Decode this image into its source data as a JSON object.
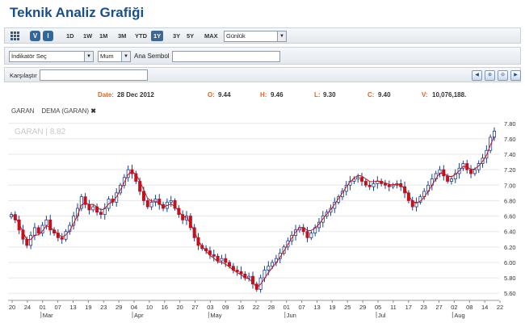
{
  "title": "Teknik Analiz Grafiği",
  "toolbar": {
    "v_label": "V",
    "i_label": "I",
    "periods": [
      "1D",
      "1W",
      "1M",
      "3M",
      "YTD",
      "1Y",
      "3Y",
      "5Y",
      "MAX"
    ],
    "active_period": "1Y",
    "interval_value": "Günlük"
  },
  "toolbar2": {
    "indicator_value": "İndikatör Seç",
    "chart_type_value": "Mum",
    "symbol_label": "Ana Sembol",
    "symbol_value": ""
  },
  "toolbar3": {
    "compare_label": "Karşılaştır",
    "compare_value": ""
  },
  "quote": {
    "date_label": "Date:",
    "date_value": "28 Dec 2012",
    "open_label": "O:",
    "open_value": "9.44",
    "high_label": "H:",
    "high_value": "9.46",
    "low_label": "L:",
    "low_value": "9.30",
    "close_label": "C:",
    "close_value": "9.40",
    "volume_label": "V:",
    "volume_value": "10,076,188."
  },
  "legend": {
    "series1": "GARAN",
    "series2": "DEMA (GARAN)",
    "remove_glyph": "✖"
  },
  "colors": {
    "up": "#ffffff",
    "down": "#c0121c",
    "dema": "#c0121c",
    "candle_outline": "#1b3f8f",
    "active_button": "#3d6896"
  },
  "chart_data": {
    "type": "candlestick",
    "watermark": "GARAN | 8.82",
    "ylim": [
      5.55,
      7.85
    ],
    "yticks": [
      5.6,
      5.8,
      6.0,
      6.2,
      6.4,
      6.6,
      6.8,
      7.0,
      7.2,
      7.4,
      7.6,
      7.8
    ],
    "x_day_ticks": [
      "20",
      "24",
      "01",
      "07",
      "13",
      "19",
      "23",
      "29",
      "04",
      "10",
      "16",
      "20",
      "27",
      "03",
      "09",
      "16",
      "22",
      "28",
      "01",
      "07",
      "13",
      "19",
      "25",
      "29",
      "05",
      "11",
      "17",
      "23",
      "27",
      "02",
      "08",
      "14",
      "22"
    ],
    "x_month_labels": [
      {
        "label": "Mar",
        "tick_index": 2
      },
      {
        "label": "Apr",
        "tick_index": 8
      },
      {
        "label": "May",
        "tick_index": 13
      },
      {
        "label": "Jun",
        "tick_index": 18
      },
      {
        "label": "Jul",
        "tick_index": 24
      },
      {
        "label": "Aug",
        "tick_index": 29
      }
    ],
    "closes": [
      6.62,
      6.55,
      6.42,
      6.3,
      6.22,
      6.35,
      6.45,
      6.38,
      6.48,
      6.55,
      6.42,
      6.38,
      6.32,
      6.3,
      6.4,
      6.48,
      6.6,
      6.7,
      6.85,
      6.75,
      6.68,
      6.72,
      6.65,
      6.62,
      6.7,
      6.82,
      6.78,
      6.9,
      7.0,
      7.1,
      7.2,
      7.15,
      7.05,
      6.92,
      6.8,
      6.72,
      6.78,
      6.82,
      6.75,
      6.7,
      6.78,
      6.8,
      6.7,
      6.62,
      6.55,
      6.6,
      6.45,
      6.32,
      6.22,
      6.18,
      6.15,
      6.1,
      6.08,
      6.02,
      6.05,
      6.0,
      5.95,
      5.9,
      5.88,
      5.85,
      5.8,
      5.82,
      5.72,
      5.65,
      5.8,
      5.9,
      5.95,
      6.0,
      6.05,
      6.12,
      6.2,
      6.28,
      6.35,
      6.42,
      6.45,
      6.4,
      6.32,
      6.38,
      6.45,
      6.52,
      6.6,
      6.65,
      6.7,
      6.78,
      6.85,
      6.92,
      7.0,
      7.05,
      7.08,
      7.1,
      7.05,
      7.0,
      6.98,
      7.02,
      7.05,
      7.02,
      7.0,
      6.98,
      7.0,
      7.02,
      6.98,
      6.9,
      6.8,
      6.72,
      6.78,
      6.85,
      6.92,
      7.0,
      7.08,
      7.15,
      7.2,
      7.12,
      7.05,
      7.08,
      7.15,
      7.22,
      7.28,
      7.2,
      7.15,
      7.2,
      7.28,
      7.35,
      7.45,
      7.62,
      7.7
    ]
  }
}
